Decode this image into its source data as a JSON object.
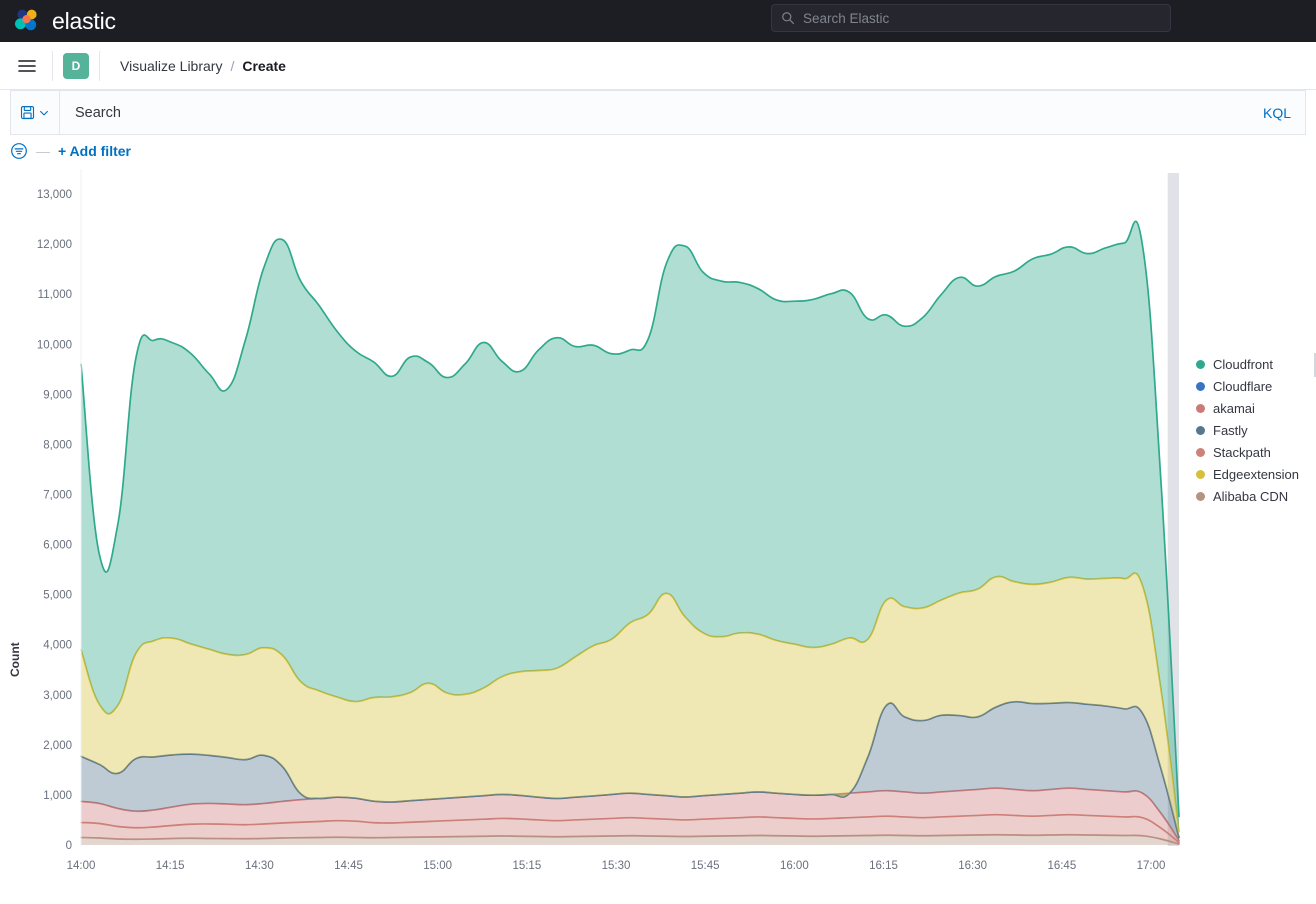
{
  "header": {
    "brand_name": "elastic",
    "logo_icon": "elastic-logo-icon",
    "search": {
      "icon": "search-icon",
      "placeholder": "Search Elastic",
      "value": ""
    }
  },
  "breadcrumb_bar": {
    "menu_icon": "hamburger-menu-icon",
    "space_badge": "D",
    "crumbs": [
      {
        "label": "Visualize Library",
        "current": false
      },
      {
        "label": "Create",
        "current": true
      }
    ],
    "separator": "/"
  },
  "query_bar": {
    "saved_query_icon": "save-disk-icon",
    "chevron_icon": "chevron-down-icon",
    "search_placeholder": "Search",
    "search_value": "",
    "language_label": "KQL"
  },
  "filter_bar": {
    "filter_icon": "filter-funnel-icon",
    "dash": "—",
    "add_filter_label": "+ Add filter"
  },
  "legend": {
    "items": [
      {
        "label": "Cloudfront",
        "color": "#2fa98c"
      },
      {
        "label": "Cloudflare",
        "color": "#3b73c4"
      },
      {
        "label": "akamai",
        "color": "#cc7a78"
      },
      {
        "label": "Fastly",
        "color": "#57778f"
      },
      {
        "label": "Stackpath",
        "color": "#cc8278"
      },
      {
        "label": "Edgeextension",
        "color": "#d6bf3a"
      },
      {
        "label": "Alibaba CDN",
        "color": "#b59382"
      }
    ]
  },
  "chart_data": {
    "type": "area",
    "stacked": true,
    "title": "",
    "xlabel": "",
    "ylabel": "Count",
    "ylim": [
      0,
      13500
    ],
    "ytick_values": [
      0,
      1000,
      2000,
      3000,
      4000,
      5000,
      6000,
      7000,
      8000,
      9000,
      10000,
      11000,
      12000,
      13000
    ],
    "ytick_labels": [
      "0",
      "1,000",
      "2,000",
      "3,000",
      "4,000",
      "5,000",
      "6,000",
      "7,000",
      "8,000",
      "9,000",
      "10,000",
      "11,000",
      "12,000",
      "13,000"
    ],
    "xtick_labels": [
      "14:00",
      "14:15",
      "14:30",
      "14:45",
      "15:00",
      "15:15",
      "15:30",
      "15:45",
      "16:00",
      "16:15",
      "16:30",
      "16:45",
      "17:00"
    ],
    "x_domain": [
      "14:00",
      "17:00"
    ],
    "grid": false,
    "legend_position": "right",
    "curve": "smooth",
    "partial_bucket_shading": {
      "from_label": "17:00",
      "color": "#dcdde3"
    },
    "x": [
      0,
      1,
      2,
      3,
      4,
      5,
      6,
      7,
      8,
      9,
      10,
      11,
      12,
      13,
      14,
      15,
      16,
      17,
      18,
      19,
      20,
      21,
      22,
      23,
      24,
      25,
      26,
      27,
      28,
      29,
      30,
      31,
      32,
      33,
      34,
      35,
      36,
      37,
      38,
      39,
      40,
      41,
      42,
      43,
      44,
      45,
      46,
      47,
      48,
      49,
      50,
      51,
      52,
      53,
      54,
      55,
      56,
      57,
      58,
      59,
      60
    ],
    "series": [
      {
        "name": "Alibaba CDN",
        "color": "#b59382",
        "values": [
          150,
          140,
          120,
          115,
          120,
          130,
          135,
          130,
          128,
          125,
          130,
          140,
          145,
          150,
          155,
          150,
          145,
          150,
          155,
          160,
          165,
          170,
          175,
          180,
          175,
          170,
          165,
          170,
          175,
          180,
          185,
          180,
          175,
          170,
          175,
          180,
          185,
          190,
          185,
          180,
          175,
          180,
          185,
          190,
          195,
          190,
          185,
          190,
          195,
          200,
          205,
          200,
          195,
          200,
          205,
          200,
          195,
          190,
          185,
          120,
          20
        ]
      },
      {
        "name": "Stackpath",
        "color": "#cc8278",
        "values": [
          300,
          290,
          250,
          230,
          240,
          260,
          280,
          290,
          285,
          280,
          290,
          300,
          310,
          320,
          330,
          325,
          300,
          290,
          300,
          310,
          320,
          330,
          340,
          350,
          345,
          330,
          320,
          330,
          340,
          350,
          360,
          350,
          340,
          330,
          340,
          350,
          360,
          370,
          360,
          350,
          345,
          350,
          360,
          370,
          380,
          370,
          360,
          370,
          380,
          390,
          400,
          390,
          380,
          390,
          400,
          390,
          380,
          370,
          360,
          220,
          30
        ]
      },
      {
        "name": "akamai",
        "color": "#cc7a78",
        "values": [
          420,
          400,
          360,
          330,
          340,
          370,
          400,
          410,
          405,
          400,
          410,
          430,
          450,
          460,
          470,
          460,
          430,
          420,
          430,
          440,
          450,
          460,
          470,
          480,
          470,
          455,
          445,
          455,
          465,
          480,
          490,
          480,
          470,
          460,
          470,
          480,
          490,
          500,
          490,
          480,
          475,
          480,
          490,
          500,
          510,
          500,
          490,
          500,
          510,
          520,
          530,
          520,
          510,
          520,
          530,
          520,
          510,
          500,
          490,
          300,
          40
        ]
      },
      {
        "name": "Fastly",
        "color": "#57778f",
        "values": [
          900,
          780,
          700,
          1050,
          1060,
          1040,
          1000,
          960,
          930,
          900,
          960,
          700,
          120,
          0,
          0,
          0,
          0,
          0,
          0,
          0,
          0,
          0,
          0,
          0,
          0,
          0,
          0,
          0,
          0,
          0,
          0,
          0,
          0,
          0,
          0,
          0,
          0,
          0,
          0,
          0,
          0,
          0,
          0,
          700,
          1700,
          1500,
          1450,
          1530,
          1500,
          1450,
          1620,
          1750,
          1740,
          1720,
          1710,
          1700,
          1690,
          1660,
          1600,
          900,
          60
        ]
      },
      {
        "name": "Edgeextension",
        "color": "#d6bf3a",
        "values": [
          2130,
          1200,
          1350,
          2100,
          2320,
          2330,
          2200,
          2120,
          2060,
          2100,
          2150,
          2220,
          2240,
          2150,
          2000,
          1930,
          2070,
          2100,
          2160,
          2320,
          2100,
          2050,
          2150,
          2350,
          2470,
          2530,
          2600,
          2800,
          3000,
          3100,
          3400,
          3600,
          4040,
          3600,
          3250,
          3150,
          3200,
          3150,
          3050,
          3000,
          2950,
          3000,
          3100,
          2350,
          2100,
          2200,
          2250,
          2300,
          2450,
          2550,
          2600,
          2400,
          2380,
          2420,
          2500,
          2500,
          2550,
          2600,
          2550,
          1600,
          120
        ]
      },
      {
        "name": "Cloudfront",
        "color": "#2fa98c",
        "values": [
          5700,
          3000,
          3600,
          5900,
          6000,
          5900,
          5800,
          5500,
          5300,
          6300,
          7600,
          8300,
          8000,
          7700,
          7300,
          7000,
          6700,
          6400,
          6700,
          6400,
          6300,
          6600,
          6900,
          6300,
          6000,
          6400,
          6600,
          6200,
          6000,
          5700,
          5450,
          5500,
          6600,
          7400,
          7200,
          7100,
          7000,
          6900,
          6800,
          6850,
          6950,
          7000,
          6900,
          6400,
          5700,
          5600,
          5800,
          6100,
          6300,
          6050,
          6000,
          6200,
          6500,
          6550,
          6600,
          6500,
          6600,
          6700,
          6800,
          4200,
          300
        ]
      },
      {
        "name": "Cloudflare",
        "color": "#3b73c4",
        "values": [
          0,
          0,
          0,
          0,
          0,
          0,
          0,
          0,
          0,
          0,
          0,
          0,
          0,
          0,
          0,
          0,
          0,
          0,
          0,
          0,
          0,
          0,
          0,
          0,
          0,
          0,
          0,
          0,
          0,
          0,
          0,
          0,
          0,
          0,
          0,
          0,
          0,
          0,
          0,
          0,
          0,
          0,
          0,
          0,
          0,
          0,
          0,
          0,
          0,
          0,
          0,
          0,
          0,
          0,
          0,
          0,
          0,
          0,
          0,
          0,
          0
        ]
      }
    ]
  }
}
